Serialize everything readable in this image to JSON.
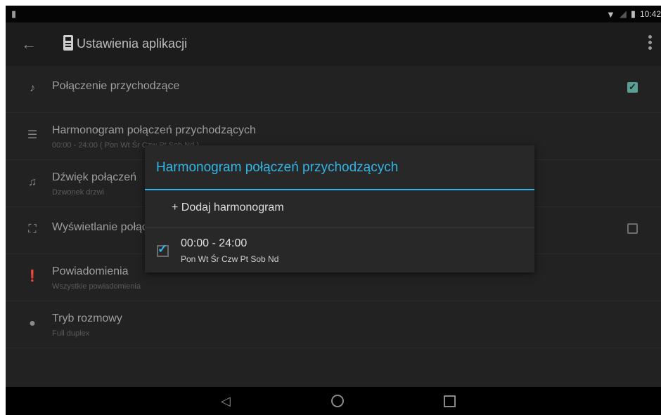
{
  "status_bar": {
    "time": "10:42",
    "icons": [
      "notification-icon",
      "wifi-icon",
      "signal-icon",
      "battery-icon"
    ]
  },
  "action_bar": {
    "title": "Ustawienia aplikacji",
    "icons": [
      "back-arrow-icon",
      "app-intercom-icon",
      "overflow-menu-icon"
    ]
  },
  "settings": {
    "items": [
      {
        "icon": "bell-icon",
        "title": "Połączenie przychodzące",
        "subtitle": "",
        "checkbox": true
      },
      {
        "icon": "schedule-icon",
        "title": "Harmonogram połączeń przychodzących",
        "subtitle": "00:00 - 24:00 ( Pon Wt Śr Czw Pt Sob Nd )",
        "checkbox": null
      },
      {
        "icon": "music-note-icon",
        "title": "Dźwięk połączeń",
        "subtitle": "Dzwonek drzwi",
        "checkbox": null
      },
      {
        "icon": "fullscreen-icon",
        "title": "Wyświetlanie połączeń",
        "subtitle": "",
        "checkbox": false
      },
      {
        "icon": "alert-icon",
        "title": "Powiadomienia",
        "subtitle": "Wszystkie powiadomienia",
        "checkbox": null
      },
      {
        "icon": "chat-icon",
        "title": "Tryb rozmowy",
        "subtitle": "Full duplex",
        "checkbox": null
      }
    ]
  },
  "dialog": {
    "title": "Harmonogram połączeń przychodzących",
    "add_label": "+ Dodaj harmonogram",
    "schedules": [
      {
        "time": "00:00 - 24:00",
        "days": "Pon Wt Śr Czw Pt Sob Nd",
        "checked": true
      }
    ]
  },
  "nav_bar": {
    "icons": [
      "nav-back-icon",
      "nav-home-icon",
      "nav-recents-icon"
    ]
  },
  "colors": {
    "accent": "#33b5e5",
    "checkbox_on": "#5a9f94",
    "background": "#222222"
  }
}
